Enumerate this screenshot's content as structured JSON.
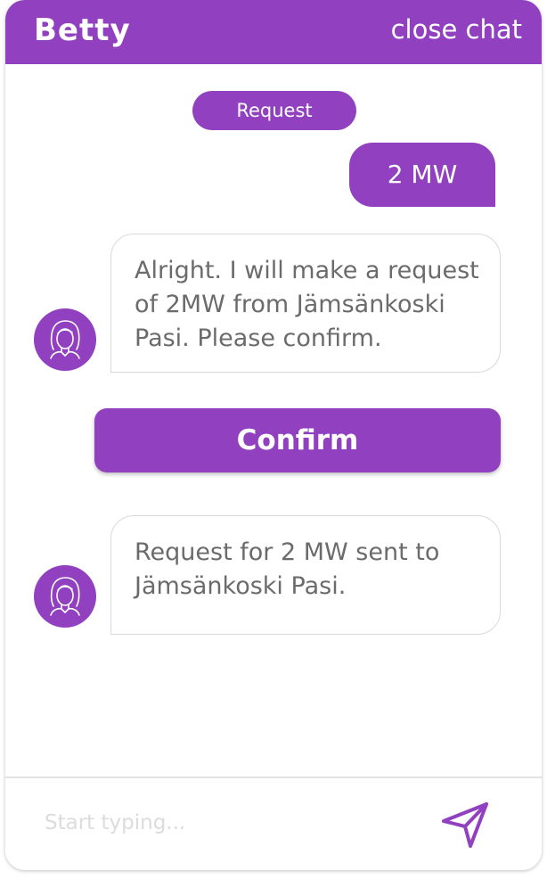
{
  "header": {
    "title": "Betty",
    "close_label": "close chat"
  },
  "messages": {
    "request_tag": "Request",
    "user_message": "2 MW",
    "bot_message_1": "Alright. I will make a request of 2MW from Jämsänkoski Pasi. Please confirm.",
    "confirm_label": "Confirm",
    "bot_message_2": "Request for 2 MW sent to Jämsänkoski Pasi."
  },
  "composer": {
    "placeholder": "Start typing..."
  },
  "icons": {
    "avatar": "woman-avatar-icon",
    "send": "send-paper-plane-icon"
  },
  "colors": {
    "accent": "#9141bf",
    "bubble_border": "#d9d9d9",
    "bot_text": "#6b6b6b"
  }
}
